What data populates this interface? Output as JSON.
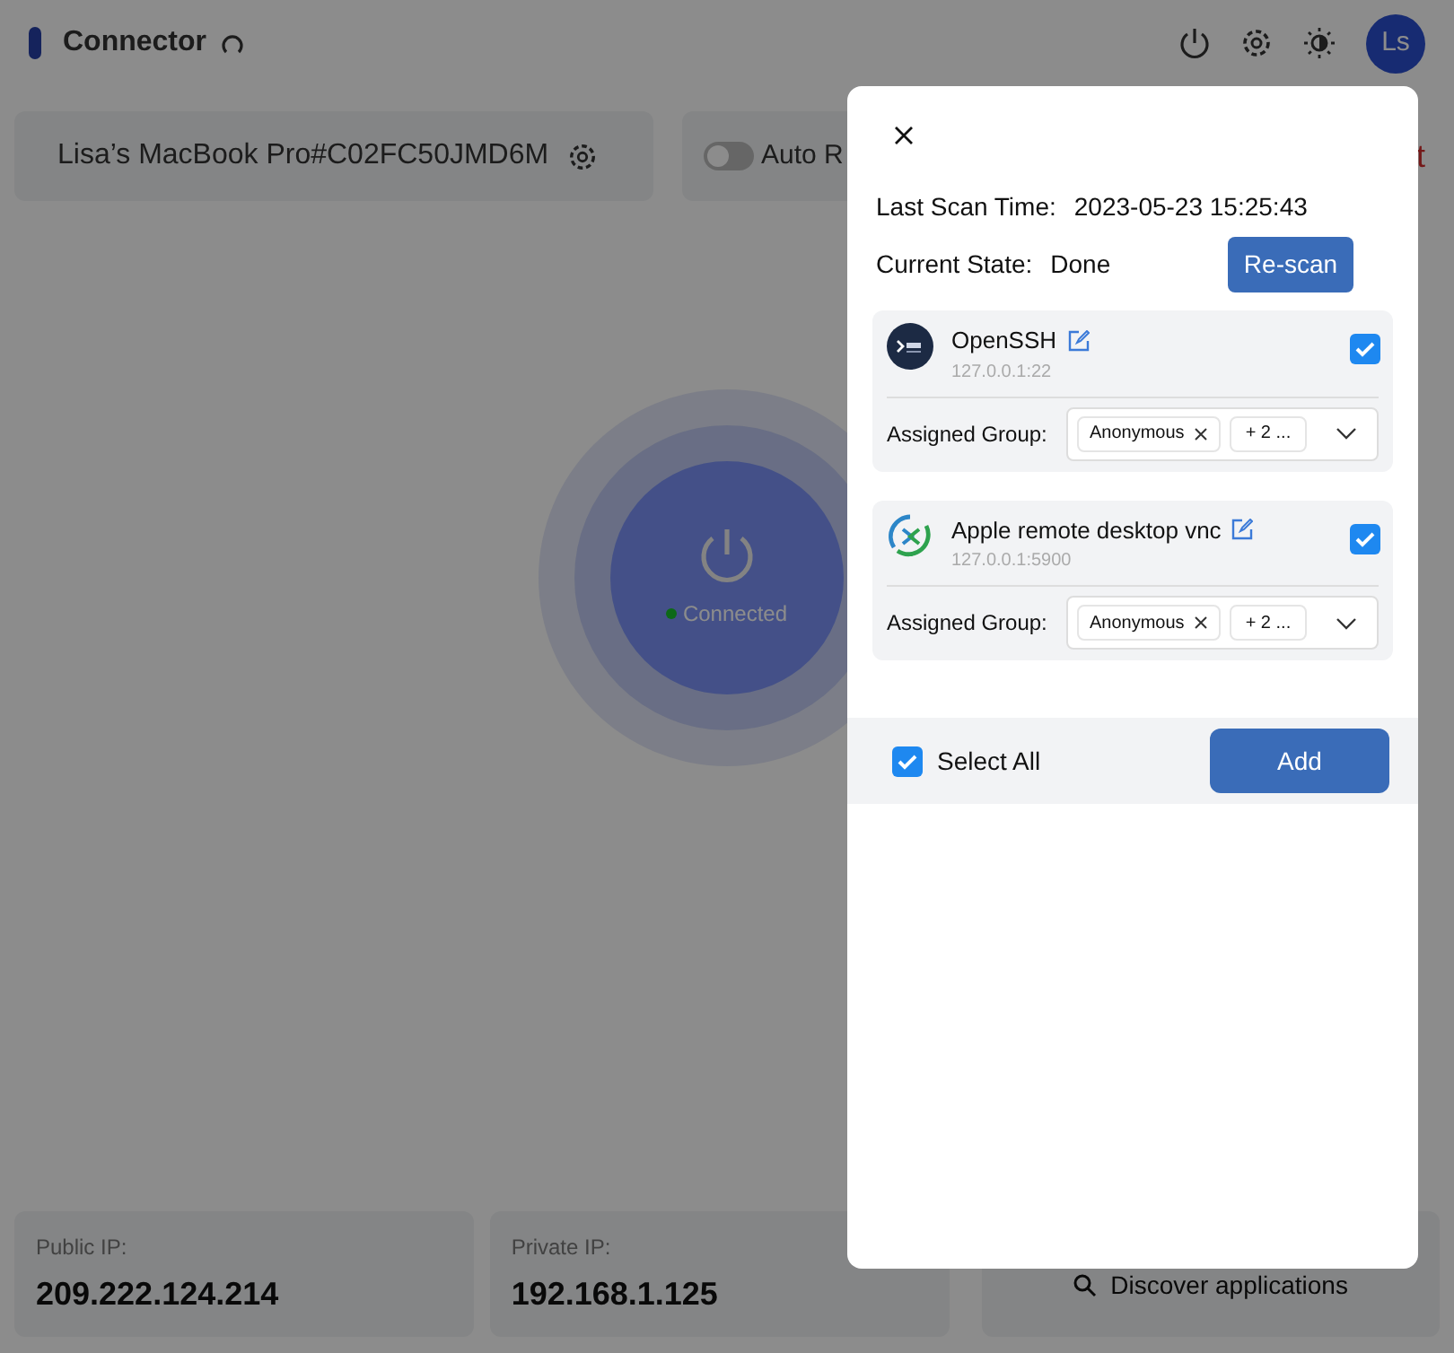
{
  "header": {
    "title": "Connector",
    "avatar": "Ls"
  },
  "device": {
    "name": "Lisa’s MacBook Pro#C02FC50JMD6M"
  },
  "auto_toggle": {
    "label": "Auto R",
    "on": false
  },
  "right_link": {
    "label": "t"
  },
  "connection": {
    "status": "Connected",
    "connected": true
  },
  "ip_cards": [
    {
      "label": "Public IP:",
      "value": "209.222.124.214"
    },
    {
      "label": "Private IP:",
      "value": "192.168.1.125"
    }
  ],
  "discover_button": {
    "label": "Discover applications"
  },
  "dialog": {
    "last_scan_label": "Last Scan Time:",
    "last_scan_value": "2023-05-23 15:25:43",
    "state_label": "Current State:",
    "state_value": "Done",
    "rescan_label": "Re-scan",
    "apps": [
      {
        "kind": "ssh",
        "name": "OpenSSH",
        "address": "127.0.0.1:22",
        "checked": true,
        "group_label": "Assigned Group:",
        "tag": "Anonymous",
        "more": "+ 2 ..."
      },
      {
        "kind": "vnc",
        "name": "Apple remote desktop vnc",
        "address": "127.0.0.1:5900",
        "checked": true,
        "group_label": "Assigned Group:",
        "tag": "Anonymous",
        "more": "+ 2 ..."
      }
    ],
    "select_all": {
      "label": "Select All",
      "checked": true
    },
    "add_label": "Add"
  }
}
